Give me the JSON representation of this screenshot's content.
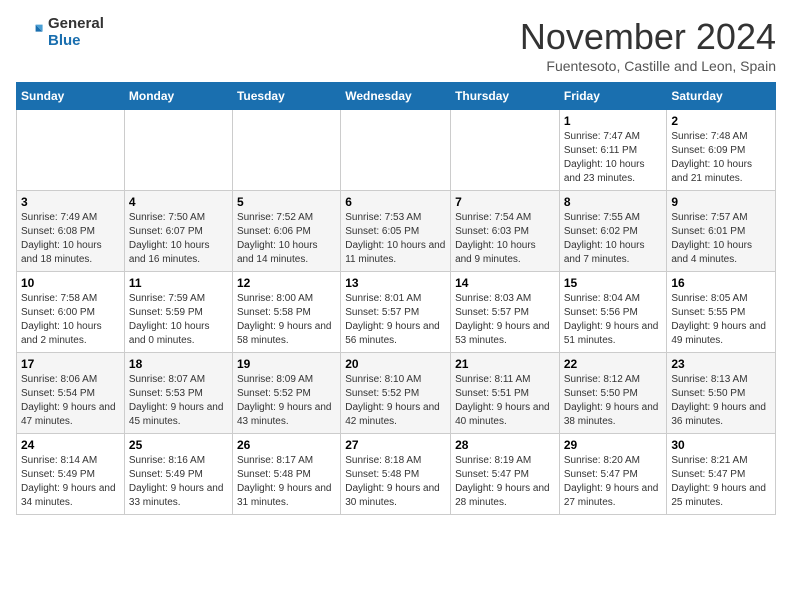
{
  "logo": {
    "general": "General",
    "blue": "Blue"
  },
  "header": {
    "month": "November 2024",
    "location": "Fuentesoto, Castille and Leon, Spain"
  },
  "weekdays": [
    "Sunday",
    "Monday",
    "Tuesday",
    "Wednesday",
    "Thursday",
    "Friday",
    "Saturday"
  ],
  "weeks": [
    [
      {
        "day": "",
        "info": ""
      },
      {
        "day": "",
        "info": ""
      },
      {
        "day": "",
        "info": ""
      },
      {
        "day": "",
        "info": ""
      },
      {
        "day": "",
        "info": ""
      },
      {
        "day": "1",
        "info": "Sunrise: 7:47 AM\nSunset: 6:11 PM\nDaylight: 10 hours and 23 minutes."
      },
      {
        "day": "2",
        "info": "Sunrise: 7:48 AM\nSunset: 6:09 PM\nDaylight: 10 hours and 21 minutes."
      }
    ],
    [
      {
        "day": "3",
        "info": "Sunrise: 7:49 AM\nSunset: 6:08 PM\nDaylight: 10 hours and 18 minutes."
      },
      {
        "day": "4",
        "info": "Sunrise: 7:50 AM\nSunset: 6:07 PM\nDaylight: 10 hours and 16 minutes."
      },
      {
        "day": "5",
        "info": "Sunrise: 7:52 AM\nSunset: 6:06 PM\nDaylight: 10 hours and 14 minutes."
      },
      {
        "day": "6",
        "info": "Sunrise: 7:53 AM\nSunset: 6:05 PM\nDaylight: 10 hours and 11 minutes."
      },
      {
        "day": "7",
        "info": "Sunrise: 7:54 AM\nSunset: 6:03 PM\nDaylight: 10 hours and 9 minutes."
      },
      {
        "day": "8",
        "info": "Sunrise: 7:55 AM\nSunset: 6:02 PM\nDaylight: 10 hours and 7 minutes."
      },
      {
        "day": "9",
        "info": "Sunrise: 7:57 AM\nSunset: 6:01 PM\nDaylight: 10 hours and 4 minutes."
      }
    ],
    [
      {
        "day": "10",
        "info": "Sunrise: 7:58 AM\nSunset: 6:00 PM\nDaylight: 10 hours and 2 minutes."
      },
      {
        "day": "11",
        "info": "Sunrise: 7:59 AM\nSunset: 5:59 PM\nDaylight: 10 hours and 0 minutes."
      },
      {
        "day": "12",
        "info": "Sunrise: 8:00 AM\nSunset: 5:58 PM\nDaylight: 9 hours and 58 minutes."
      },
      {
        "day": "13",
        "info": "Sunrise: 8:01 AM\nSunset: 5:57 PM\nDaylight: 9 hours and 56 minutes."
      },
      {
        "day": "14",
        "info": "Sunrise: 8:03 AM\nSunset: 5:57 PM\nDaylight: 9 hours and 53 minutes."
      },
      {
        "day": "15",
        "info": "Sunrise: 8:04 AM\nSunset: 5:56 PM\nDaylight: 9 hours and 51 minutes."
      },
      {
        "day": "16",
        "info": "Sunrise: 8:05 AM\nSunset: 5:55 PM\nDaylight: 9 hours and 49 minutes."
      }
    ],
    [
      {
        "day": "17",
        "info": "Sunrise: 8:06 AM\nSunset: 5:54 PM\nDaylight: 9 hours and 47 minutes."
      },
      {
        "day": "18",
        "info": "Sunrise: 8:07 AM\nSunset: 5:53 PM\nDaylight: 9 hours and 45 minutes."
      },
      {
        "day": "19",
        "info": "Sunrise: 8:09 AM\nSunset: 5:52 PM\nDaylight: 9 hours and 43 minutes."
      },
      {
        "day": "20",
        "info": "Sunrise: 8:10 AM\nSunset: 5:52 PM\nDaylight: 9 hours and 42 minutes."
      },
      {
        "day": "21",
        "info": "Sunrise: 8:11 AM\nSunset: 5:51 PM\nDaylight: 9 hours and 40 minutes."
      },
      {
        "day": "22",
        "info": "Sunrise: 8:12 AM\nSunset: 5:50 PM\nDaylight: 9 hours and 38 minutes."
      },
      {
        "day": "23",
        "info": "Sunrise: 8:13 AM\nSunset: 5:50 PM\nDaylight: 9 hours and 36 minutes."
      }
    ],
    [
      {
        "day": "24",
        "info": "Sunrise: 8:14 AM\nSunset: 5:49 PM\nDaylight: 9 hours and 34 minutes."
      },
      {
        "day": "25",
        "info": "Sunrise: 8:16 AM\nSunset: 5:49 PM\nDaylight: 9 hours and 33 minutes."
      },
      {
        "day": "26",
        "info": "Sunrise: 8:17 AM\nSunset: 5:48 PM\nDaylight: 9 hours and 31 minutes."
      },
      {
        "day": "27",
        "info": "Sunrise: 8:18 AM\nSunset: 5:48 PM\nDaylight: 9 hours and 30 minutes."
      },
      {
        "day": "28",
        "info": "Sunrise: 8:19 AM\nSunset: 5:47 PM\nDaylight: 9 hours and 28 minutes."
      },
      {
        "day": "29",
        "info": "Sunrise: 8:20 AM\nSunset: 5:47 PM\nDaylight: 9 hours and 27 minutes."
      },
      {
        "day": "30",
        "info": "Sunrise: 8:21 AM\nSunset: 5:47 PM\nDaylight: 9 hours and 25 minutes."
      }
    ]
  ]
}
